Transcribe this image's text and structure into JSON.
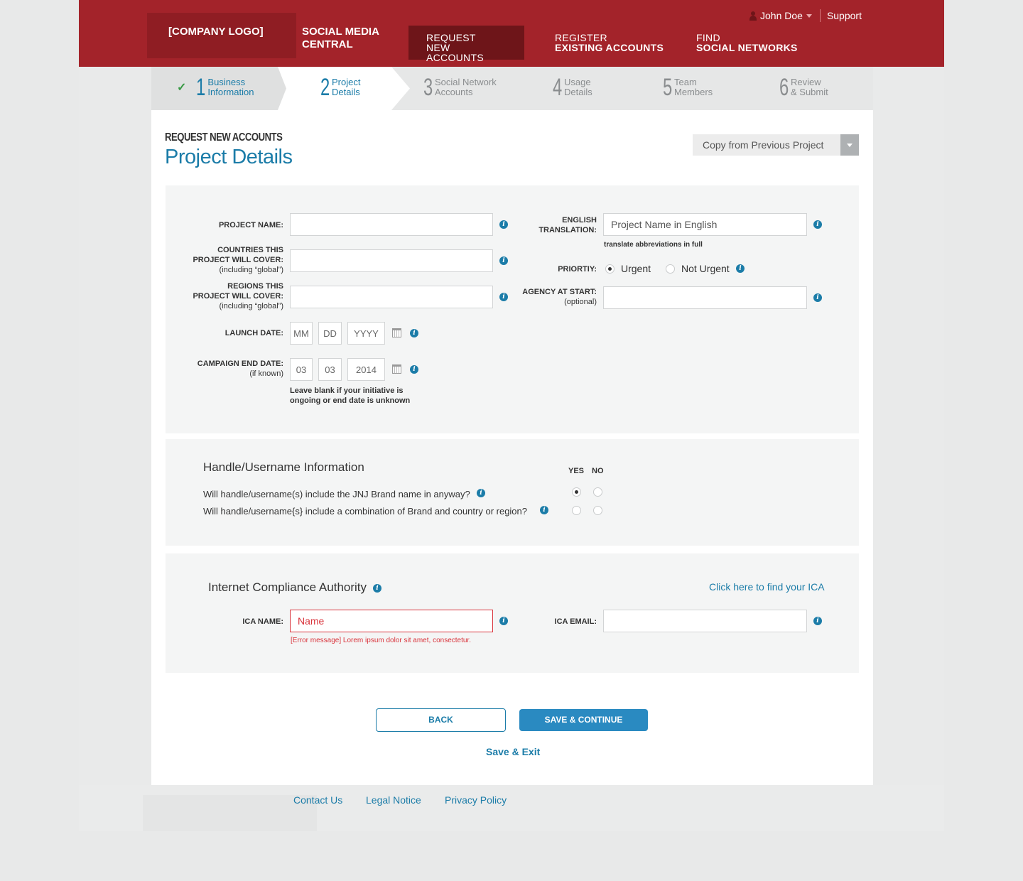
{
  "header": {
    "logo": "[COMPANY LOGO]",
    "brand_line1": "SOCIAL MEDIA",
    "brand_line2": "CENTRAL",
    "nav": [
      {
        "line1": "REQUEST",
        "line2": "NEW ACCOUNTS"
      },
      {
        "line1": "REGISTER",
        "line2": "EXISTING ACCOUNTS"
      },
      {
        "line1": "FIND",
        "line2": "SOCIAL NETWORKS"
      }
    ],
    "user_name": "John Doe",
    "support": "Support"
  },
  "steps": [
    {
      "num": "1",
      "line1": "Business",
      "line2": "Information"
    },
    {
      "num": "2",
      "line1": "Project",
      "line2": "Details"
    },
    {
      "num": "3",
      "line1": "Social Network",
      "line2": "Accounts"
    },
    {
      "num": "4",
      "line1": "Usage",
      "line2": "Details"
    },
    {
      "num": "5",
      "line1": "Team",
      "line2": "Members"
    },
    {
      "num": "6",
      "line1": "Review",
      "line2": "& Submit"
    }
  ],
  "page": {
    "eyebrow": "REQUEST NEW ACCOUNTS",
    "title": "Project Details",
    "copy_button": "Copy from Previous Project"
  },
  "form": {
    "project_name_label": "PROJECT NAME:",
    "countries_label_1": "COUNTRIES THIS",
    "countries_label_2": "PROJECT WILL COVER:",
    "countries_label_sub": "(including “global”)",
    "regions_label_1": "REGIONS THIS",
    "regions_label_2": "PROJECT WILL COVER:",
    "regions_label_sub": "(including “global”)",
    "launch_label": "LAUNCH DATE:",
    "launch_mm": "MM",
    "launch_dd": "DD",
    "launch_yyyy": "YYYY",
    "end_label": "CAMPAIGN END DATE:",
    "end_label_sub": "(if known)",
    "end_mm": "03",
    "end_dd": "03",
    "end_yyyy": "2014",
    "end_helper_1": "Leave blank if your initiative is",
    "end_helper_2": "ongoing or end date is unknown",
    "english_label_1": "ENGLISH",
    "english_label_2": "TRANSLATION:",
    "english_placeholder": "Project Name in English",
    "english_helper": "translate abbreviations in full",
    "priority_label": "PRIORTIY:",
    "urgent": "Urgent",
    "not_urgent": "Not Urgent",
    "agency_label": "AGENCY AT START:",
    "agency_sub": "(optional)"
  },
  "handle": {
    "title": "Handle/Username Information",
    "yes": "YES",
    "no": "NO",
    "q1": "Will handle/username(s) include the JNJ Brand name in anyway?",
    "q2": "Will handle/username{s} include a combination of Brand and country or region?"
  },
  "ica": {
    "title": "Internet Compliance Authority",
    "find_link": "Click here to find your ICA",
    "name_label": "ICA NAME:",
    "name_value": "Name",
    "error": "[Error message] Lorem ipsum dolor sit amet, consectetur.",
    "email_label": "ICA EMAIL:"
  },
  "actions": {
    "back": "BACK",
    "save_continue": "SAVE & CONTINUE",
    "save_exit": "Save & Exit"
  },
  "footer": {
    "contact": "Contact Us",
    "legal": "Legal Notice",
    "privacy": "Privacy Policy"
  },
  "colors": {
    "brand_red": "#a3232a",
    "accent_blue": "#1b7ca8",
    "error_red": "#d9343c"
  }
}
